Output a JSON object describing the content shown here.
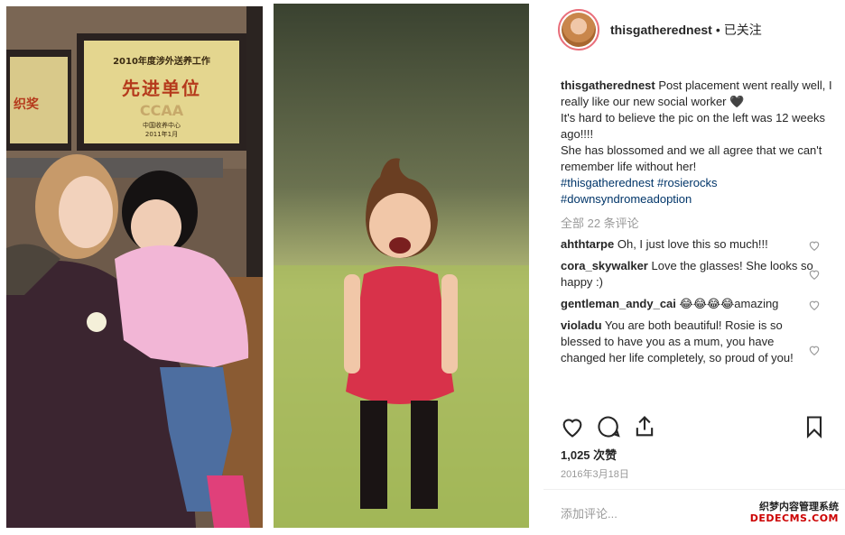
{
  "header": {
    "username": "thisgatherednest",
    "separator": "•",
    "follow_label": "已关注"
  },
  "left_photo_plaque": {
    "line1": "2010年度涉外送养工作",
    "line2": "先进单位",
    "line3": "CCAA",
    "line4": "中国收养中心",
    "line5": "2011年1月",
    "side_text": "织奖"
  },
  "caption": {
    "username": "thisgatherednest",
    "text_1": "Post placement went really well, I really like our new social worker 🖤",
    "text_2": "It's hard to believe the pic on the left was 12 weeks ago!!!!",
    "text_3": "She has blossomed and we all agree that we can't remember life without her!",
    "tags": [
      "#thisgatherednest",
      "#rosierocks",
      "#downsyndromeadoption"
    ]
  },
  "all_comments_label": "全部 22 条评论",
  "comments": [
    {
      "user": "ahthtarpe",
      "text": "Oh, I just love this so much!!!"
    },
    {
      "user": "cora_skywalker",
      "text": "Love the glasses! She looks so happy :)"
    },
    {
      "user": "gentleman_andy_cai",
      "text": "😂😂😂😂amazing"
    },
    {
      "user": "violadu",
      "text": "You are both beautiful! Rosie is so blessed to have you as a mum, you have changed her life completely, so proud of you!"
    }
  ],
  "icons": {
    "like": "heart-icon",
    "comment": "comment-icon",
    "share": "share-icon",
    "save": "bookmark-icon"
  },
  "likes_label": "1,025 次赞",
  "date_label": "2016年3月18日",
  "add_comment_placeholder": "添加评论...",
  "watermark": {
    "line1": "织梦内容管理系统",
    "line2": "DEDECMS.COM"
  },
  "colors": {
    "text": "#262626",
    "muted": "#999999",
    "hashtag": "#003569",
    "avatar_ring": "#e96f7b"
  }
}
